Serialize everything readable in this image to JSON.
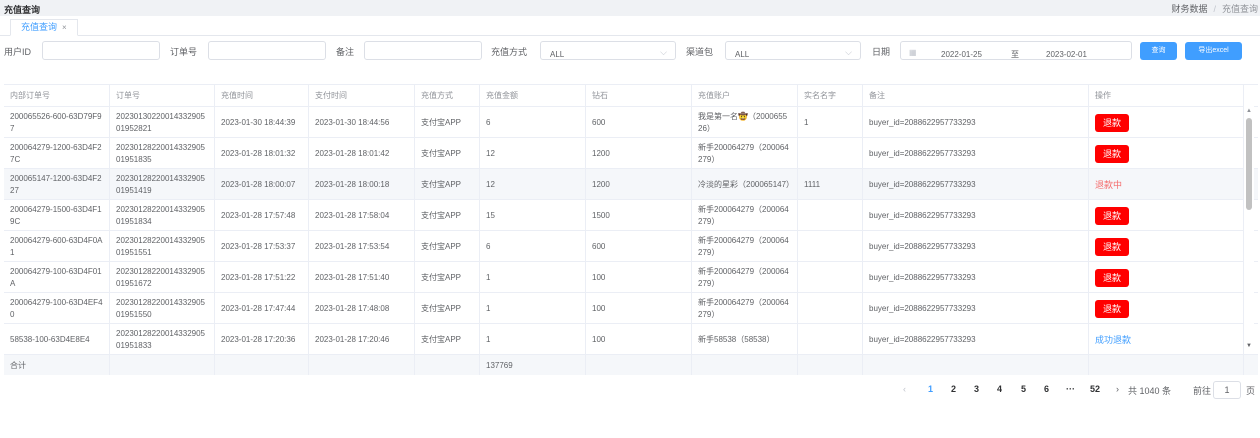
{
  "header": {
    "title": "充值查询",
    "breadcrumb": [
      "财务数据",
      "充值查询"
    ],
    "breadcrumb_sep": "/"
  },
  "tabs": [
    {
      "label": "充值查询",
      "close": "×"
    }
  ],
  "filters": {
    "user_id_label": "用户ID",
    "user_id_value": "",
    "order_no_label": "订单号",
    "order_no_value": "",
    "remark_label": "备注",
    "remark_value": "",
    "pay_method_label": "充值方式",
    "pay_method_value": "ALL",
    "channel_label": "渠道包",
    "channel_value": "ALL",
    "date_label": "日期",
    "date_start": "2022-01-25",
    "date_sep": "至",
    "date_end": "2023-02-01",
    "query_button": "查询",
    "export_button": "导出excel"
  },
  "table": {
    "columns": [
      "内部订单号",
      "订单号",
      "充值时间",
      "支付时间",
      "充值方式",
      "充值金额",
      "钻石",
      "充值账户",
      "实名名字",
      "备注",
      "操作"
    ],
    "rows": [
      {
        "internal": "200065526-600-63D79F97",
        "order": "2023013022001433290501952821",
        "charge_time": "2023-01-30 18:44:39",
        "pay_time": "2023-01-30 18:44:56",
        "method": "支付宝APP",
        "amount": "6",
        "diamond": "600",
        "account": "我是第一名🤠（200065526）",
        "real_name": "1",
        "remark": "buyer_id=2088622957733293",
        "action": "退款",
        "action_type": "button"
      },
      {
        "internal": "200064279-1200-63D4F27C",
        "order": "2023012822001433290501951835",
        "charge_time": "2023-01-28 18:01:32",
        "pay_time": "2023-01-28 18:01:42",
        "method": "支付宝APP",
        "amount": "12",
        "diamond": "1200",
        "account": "新手200064279（200064279）",
        "real_name": "",
        "remark": "buyer_id=2088622957733293",
        "action": "退款",
        "action_type": "button"
      },
      {
        "internal": "200065147-1200-63D4F227",
        "order": "2023012822001433290501951419",
        "charge_time": "2023-01-28 18:00:07",
        "pay_time": "2023-01-28 18:00:18",
        "method": "支付宝APP",
        "amount": "12",
        "diamond": "1200",
        "account": "冷淡的星彩（200065147）",
        "real_name": "1111",
        "remark": "buyer_id=2088622957733293",
        "action": "退款中",
        "action_type": "red"
      },
      {
        "internal": "200064279-1500-63D4F19C",
        "order": "2023012822001433290501951834",
        "charge_time": "2023-01-28 17:57:48",
        "pay_time": "2023-01-28 17:58:04",
        "method": "支付宝APP",
        "amount": "15",
        "diamond": "1500",
        "account": "新手200064279（200064279）",
        "real_name": "",
        "remark": "buyer_id=2088622957733293",
        "action": "退款",
        "action_type": "button"
      },
      {
        "internal": "200064279-600-63D4F0A1",
        "order": "2023012822001433290501951551",
        "charge_time": "2023-01-28 17:53:37",
        "pay_time": "2023-01-28 17:53:54",
        "method": "支付宝APP",
        "amount": "6",
        "diamond": "600",
        "account": "新手200064279（200064279）",
        "real_name": "",
        "remark": "buyer_id=2088622957733293",
        "action": "退款",
        "action_type": "button"
      },
      {
        "internal": "200064279-100-63D4F01A",
        "order": "2023012822001433290501951672",
        "charge_time": "2023-01-28 17:51:22",
        "pay_time": "2023-01-28 17:51:40",
        "method": "支付宝APP",
        "amount": "1",
        "diamond": "100",
        "account": "新手200064279（200064279）",
        "real_name": "",
        "remark": "buyer_id=2088622957733293",
        "action": "退款",
        "action_type": "button"
      },
      {
        "internal": "200064279-100-63D4EF40",
        "order": "2023012822001433290501951550",
        "charge_time": "2023-01-28 17:47:44",
        "pay_time": "2023-01-28 17:48:08",
        "method": "支付宝APP",
        "amount": "1",
        "diamond": "100",
        "account": "新手200064279（200064279）",
        "real_name": "",
        "remark": "buyer_id=2088622957733293",
        "action": "退款",
        "action_type": "button"
      },
      {
        "internal": "58538-100-63D4E8E4",
        "order": "2023012822001433290501951833",
        "charge_time": "2023-01-28 17:20:36",
        "pay_time": "2023-01-28 17:20:46",
        "method": "支付宝APP",
        "amount": "1",
        "diamond": "100",
        "account": "新手58538（58538）",
        "real_name": "",
        "remark": "buyer_id=2088622957733293",
        "action": "成功退款",
        "action_type": "blue"
      }
    ],
    "footer_label": "合计",
    "footer_amount": "137769"
  },
  "pagination": {
    "prev": "‹",
    "pages": [
      "1",
      "2",
      "3",
      "4",
      "5",
      "6"
    ],
    "active_page": "1",
    "ellipsis": "···",
    "last_page": "52",
    "next": "›",
    "total": "共 1040 条",
    "goto_label": "前往",
    "goto_value": "1",
    "goto_unit": "页"
  },
  "colors": {
    "primary": "#409eff",
    "danger": "#ff0000",
    "danger_text": "#f56c6c"
  }
}
